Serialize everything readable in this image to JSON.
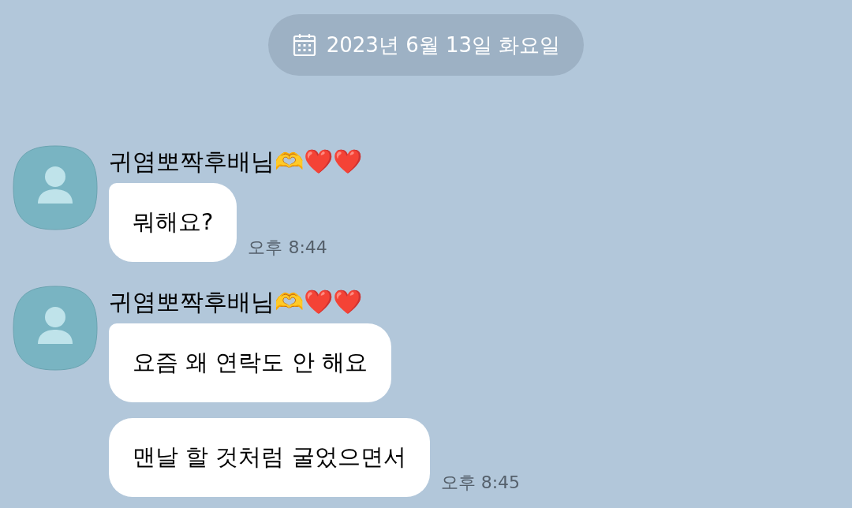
{
  "date_divider": "2023년 6월 13일 화요일",
  "groups": [
    {
      "sender": "귀염뽀짝후배님🫶❤️❤️",
      "messages": [
        {
          "text": "뭐해요?",
          "time": "오후 8:44"
        }
      ]
    },
    {
      "sender": "귀염뽀짝후배님🫶❤️❤️",
      "messages": [
        {
          "text": "요즘 왜 연락도 안 해요"
        },
        {
          "text": "맨날 할 것처럼 굴었으면서",
          "time": "오후 8:45"
        }
      ]
    }
  ]
}
